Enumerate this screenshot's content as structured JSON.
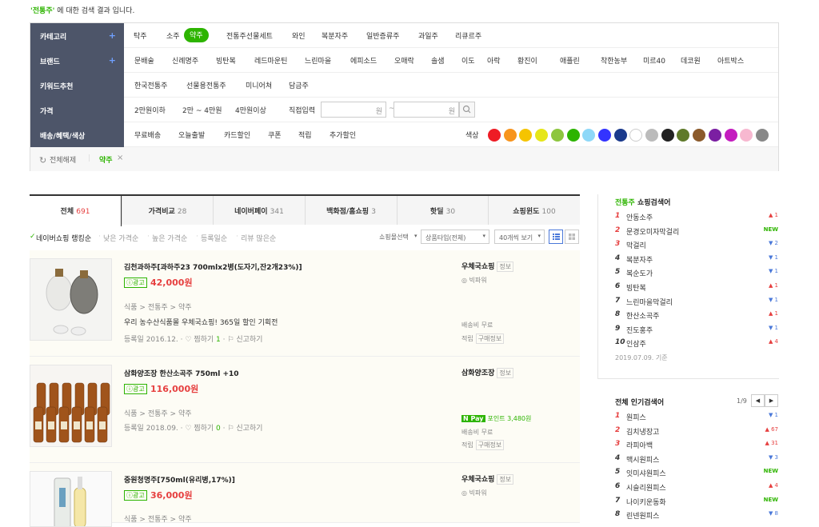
{
  "notice": {
    "keyword": "'전통주'",
    "text": " 에 대한 검색 결과 입니다."
  },
  "filter": {
    "category": {
      "label": "카테고리",
      "items": [
        "탁주",
        "소주",
        "약주",
        "전통주선물세트",
        "와인",
        "복분자주",
        "일반증류주",
        "과일주",
        "리큐르주"
      ],
      "selected": "약주"
    },
    "brand": {
      "label": "브랜드",
      "items": [
        "문배술",
        "신례명주",
        "빙탄복",
        "레드마운틴",
        "느린마을",
        "에피소드",
        "오매락",
        "솔샘",
        "이도",
        "아락",
        "황진이",
        "애플린",
        "착한농부",
        "미르40",
        "데코원",
        "아트박스"
      ]
    },
    "keyword": {
      "label": "키워드추천",
      "items": [
        "한국전통주",
        "선물용전통주",
        "미니어쳐",
        "담금주"
      ]
    },
    "price": {
      "label": "가격",
      "items": [
        "2만원이하",
        "2만 ~ 4만원",
        "4만원이상"
      ],
      "direct": "직접입력",
      "unit_min": "원",
      "tilde": "~",
      "unit_max": "원"
    },
    "benefit": {
      "label": "배송/혜택/색상",
      "items": [
        "무료배송",
        "오늘출발",
        "카드할인",
        "쿠폰",
        "적립",
        "추가할인"
      ],
      "color_label": "색상"
    },
    "colors": [
      "#ee1c25",
      "#f7941d",
      "#f5c400",
      "#e6e619",
      "#8dc63f",
      "#2db400",
      "#8ed8f8",
      "#3333ff",
      "#1b3a8c",
      "#ffffff",
      "#bbbbbb",
      "#222222",
      "#5f7a2a",
      "#8b5a2b",
      "#7b1fa2",
      "#c41dbf",
      "#f7b8d0",
      "#888888"
    ],
    "reset": {
      "label": "전체해제",
      "chip": "약주"
    }
  },
  "tabs": [
    {
      "label": "전체",
      "count": "691"
    },
    {
      "label": "가격비교",
      "count": "28"
    },
    {
      "label": "네이버페이",
      "count": "341"
    },
    {
      "label": "백화점/홈쇼핑",
      "count": "3"
    },
    {
      "label": "핫딜",
      "count": "30"
    },
    {
      "label": "쇼핑윈도",
      "count": "100"
    }
  ],
  "sort": {
    "options": [
      "네이버쇼핑 랭킹순",
      "낮은 가격순",
      "높은 가격순",
      "등록일순",
      "리뷰 많은순"
    ],
    "mall_select": "쇼핑몰선택",
    "product_type": "상품타입(전체)",
    "per_page": "40개씩 보기"
  },
  "products": [
    {
      "title": "김천과하주[과하주23 700mlx2병(도자기,잔2개23%)]",
      "ad": "광고",
      "price": "42,000원",
      "cat": [
        "식품",
        "전통주",
        "약주"
      ],
      "desc": "우리 농수산식품몰 우체국쇼핑! 365일 할인 기획전",
      "date": "등록일 2016.12.",
      "wish": "찜하기",
      "wish_count": "1",
      "report": "신고하기",
      "mall": "우체국쇼핑",
      "mall_tag": "정보",
      "grade": "빅파워",
      "ship": "배송비 무료",
      "point": "적립",
      "point_tag": "구매정보"
    },
    {
      "title": "삼화양조장 한산소곡주 750ml +10",
      "ad": "광고",
      "price": "116,000원",
      "cat": [
        "식품",
        "전통주",
        "약주"
      ],
      "date": "등록일 2018.09.",
      "wish": "찜하기",
      "wish_count": "0",
      "report": "신고하기",
      "mall": "삼화양조장",
      "mall_tag": "정보",
      "npay_badge": "N Pay",
      "npay": "포인트 3,480원",
      "ship": "배송비 무료",
      "point": "적립",
      "point_tag": "구매정보"
    },
    {
      "title": "중원청명주[750ml(유리병,17%)]",
      "ad": "광고",
      "price": "36,000원",
      "cat": [
        "식품",
        "전통주",
        "약주"
      ],
      "mall": "우체국쇼핑",
      "mall_tag": "정보",
      "grade": "빅파워"
    }
  ],
  "right": {
    "shop_title_keyword": "전통주",
    "shop_title": " 쇼핑검색어",
    "shop_ranks": [
      {
        "n": "1",
        "t": "안동소주",
        "ch": "▲ 1",
        "dir": "up"
      },
      {
        "n": "2",
        "t": "문경오미자막걸리",
        "ch": "NEW",
        "dir": "new"
      },
      {
        "n": "3",
        "t": "막걸리",
        "ch": "▼ 2",
        "dir": "down"
      },
      {
        "n": "4",
        "t": "복분자주",
        "ch": "▼ 1",
        "dir": "down"
      },
      {
        "n": "5",
        "t": "복순도가",
        "ch": "▼ 1",
        "dir": "down"
      },
      {
        "n": "6",
        "t": "빙탄복",
        "ch": "▲ 1",
        "dir": "up"
      },
      {
        "n": "7",
        "t": "느린마을막걸리",
        "ch": "▼ 1",
        "dir": "down"
      },
      {
        "n": "8",
        "t": "한산소곡주",
        "ch": "▲ 1",
        "dir": "up"
      },
      {
        "n": "9",
        "t": "진도홍주",
        "ch": "▼ 1",
        "dir": "down"
      },
      {
        "n": "10",
        "t": "인삼주",
        "ch": "▲ 4",
        "dir": "up"
      }
    ],
    "shop_date": "2019.07.09. 기준",
    "pop_title": "전체 인기검색어",
    "pop_page": "1/9",
    "pop_ranks": [
      {
        "n": "1",
        "t": "원피스",
        "ch": "▼ 1",
        "dir": "down"
      },
      {
        "n": "2",
        "t": "김치냉장고",
        "ch": "▲ 67",
        "dir": "up"
      },
      {
        "n": "3",
        "t": "라피아백",
        "ch": "▲ 31",
        "dir": "up"
      },
      {
        "n": "4",
        "t": "맥시원피스",
        "ch": "▼ 3",
        "dir": "down"
      },
      {
        "n": "5",
        "t": "잇미샤원피스",
        "ch": "NEW",
        "dir": "new"
      },
      {
        "n": "6",
        "t": "시슬리원피스",
        "ch": "▲ 4",
        "dir": "up"
      },
      {
        "n": "7",
        "t": "나이키운동화",
        "ch": "NEW",
        "dir": "new"
      },
      {
        "n": "8",
        "t": "린넨원피스",
        "ch": "▼ 8",
        "dir": "down"
      }
    ]
  }
}
